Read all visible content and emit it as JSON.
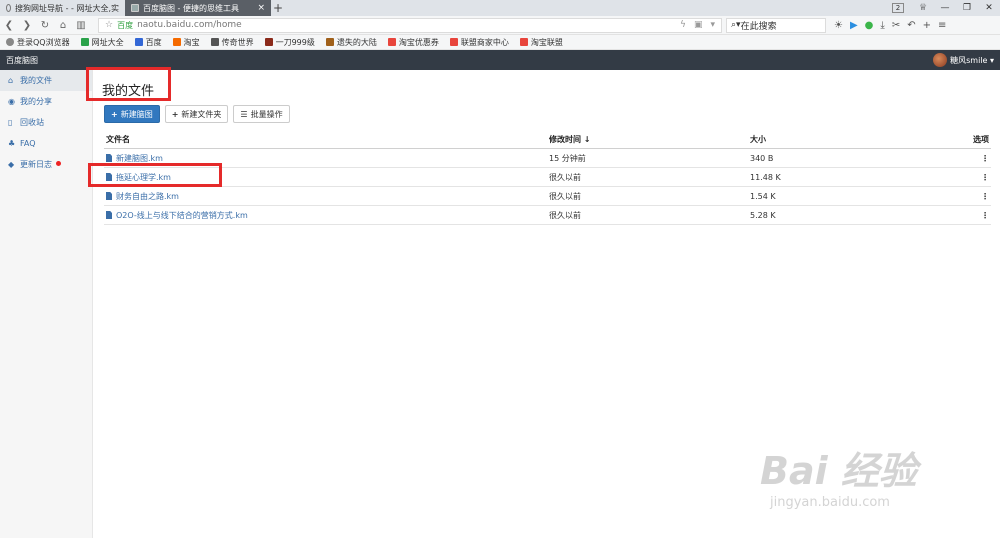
{
  "browser": {
    "tabs": [
      {
        "label": "搜狗网址导航 - - 网址大全,实",
        "active": false
      },
      {
        "label": "百度脑图 - 便捷的思维工具",
        "active": true
      }
    ],
    "new_tab": "+",
    "tab_count": "2",
    "address": {
      "site_label": "百度",
      "url": "naotu.baidu.com/home"
    },
    "search_placeholder": "在此搜索",
    "bookmarks": [
      {
        "label": "登录QQ浏览器",
        "icon": "qq-icon",
        "color": "#888888"
      },
      {
        "label": "网址大全",
        "icon": "sogou-icon",
        "color": "#2aa24a"
      },
      {
        "label": "百度",
        "icon": "baidu-icon",
        "color": "#3367d6"
      },
      {
        "label": "淘宝",
        "icon": "taobao-icon",
        "color": "#f56a00"
      },
      {
        "label": "传奇世界",
        "icon": "game-icon",
        "color": "#555555"
      },
      {
        "label": "一刀999级",
        "icon": "game-icon",
        "color": "#8b2a1a"
      },
      {
        "label": "遗失的大陆",
        "icon": "game-icon",
        "color": "#a0601a"
      },
      {
        "label": "淘宝优惠券",
        "icon": "coupon-icon",
        "color": "#e8453c"
      },
      {
        "label": "联盟商家中心",
        "icon": "alliance-icon",
        "color": "#e8453c"
      },
      {
        "label": "淘宝联盟",
        "icon": "alliance-icon",
        "color": "#e8453c"
      }
    ]
  },
  "app": {
    "name": "百度脑图",
    "user": "糖风smile"
  },
  "sidebar": {
    "items": [
      {
        "label": "我的文件",
        "icon": "home-icon",
        "active": true
      },
      {
        "label": "我的分享",
        "icon": "share-icon",
        "active": false
      },
      {
        "label": "回收站",
        "icon": "trash-icon",
        "active": false
      },
      {
        "label": "FAQ",
        "icon": "help-icon",
        "active": false
      },
      {
        "label": "更新日志",
        "icon": "tag-icon",
        "active": false
      }
    ]
  },
  "main": {
    "title": "我的文件",
    "buttons": {
      "new_map": "新建脑图",
      "new_folder": "新建文件夹",
      "batch": "批量操作"
    },
    "table": {
      "headers": {
        "name": "文件名",
        "time": "修改时间",
        "size": "大小",
        "options": "选项"
      },
      "rows": [
        {
          "name": "新建脑图.km",
          "time": "15 分钟前",
          "size": "340 B"
        },
        {
          "name": "拖延心理学.km",
          "time": "很久以前",
          "size": "11.48 K"
        },
        {
          "name": "财务自由之路.km",
          "time": "很久以前",
          "size": "1.54 K"
        },
        {
          "name": "O2O-线上与线下结合的营销方式.km",
          "time": "很久以前",
          "size": "5.28 K"
        }
      ]
    }
  },
  "watermark": {
    "big": "Bai 经验",
    "small": "jingyan.baidu.com"
  }
}
